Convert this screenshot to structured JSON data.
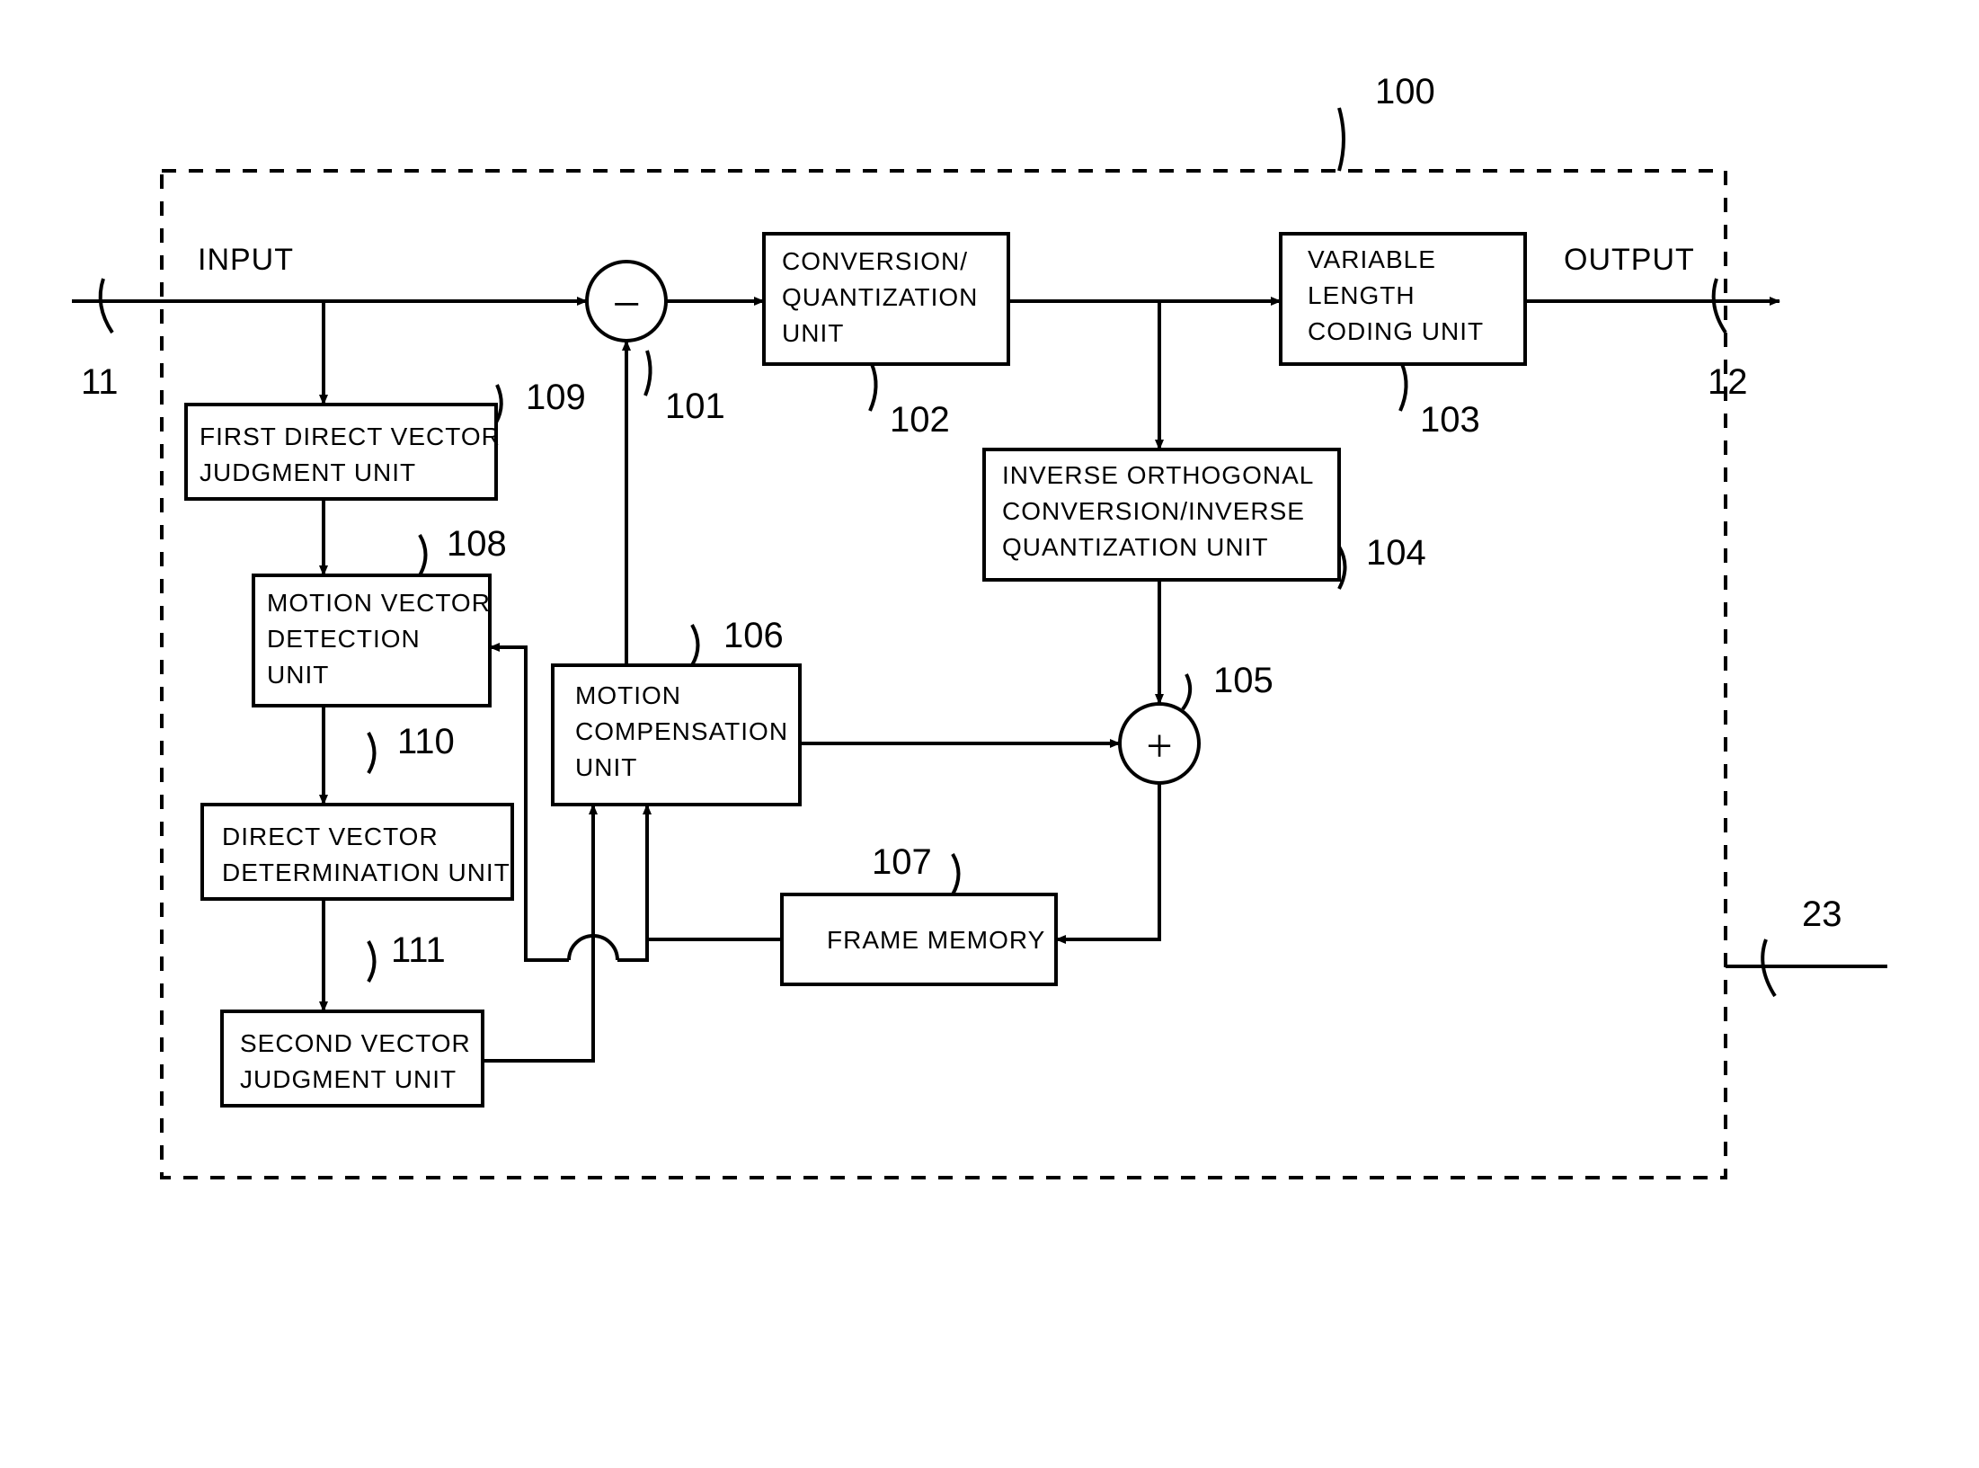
{
  "io": {
    "input": "INPUT",
    "output": "OUTPUT"
  },
  "blocks": {
    "b102": {
      "l1": "CONVERSION/",
      "l2": "QUANTIZATION",
      "l3": "UNIT"
    },
    "b103": {
      "l1": "VARIABLE",
      "l2": "LENGTH",
      "l3": "CODING UNIT"
    },
    "b104": {
      "l1": "INVERSE ORTHOGONAL",
      "l2": "CONVERSION/INVERSE",
      "l3": "QUANTIZATION UNIT"
    },
    "b106": {
      "l1": "MOTION",
      "l2": "COMPENSATION",
      "l3": "UNIT"
    },
    "b107": {
      "l1": "FRAME MEMORY"
    },
    "b108": {
      "l1": "MOTION VECTOR",
      "l2": "DETECTION",
      "l3": "UNIT"
    },
    "b109": {
      "l1": "FIRST DIRECT VECTOR",
      "l2": "JUDGMENT UNIT"
    },
    "b110": {
      "l1": "DIRECT VECTOR",
      "l2": "DETERMINATION UNIT"
    },
    "b111": {
      "l1": "SECOND VECTOR",
      "l2": "JUDGMENT UNIT"
    }
  },
  "labels": {
    "n11": "11",
    "n12": "12",
    "n23": "23",
    "n100": "100",
    "n101": "101",
    "n102": "102",
    "n103": "103",
    "n104": "104",
    "n105": "105",
    "n106": "106",
    "n107": "107",
    "n108": "108",
    "n109": "109",
    "n110": "110",
    "n111": "111"
  }
}
